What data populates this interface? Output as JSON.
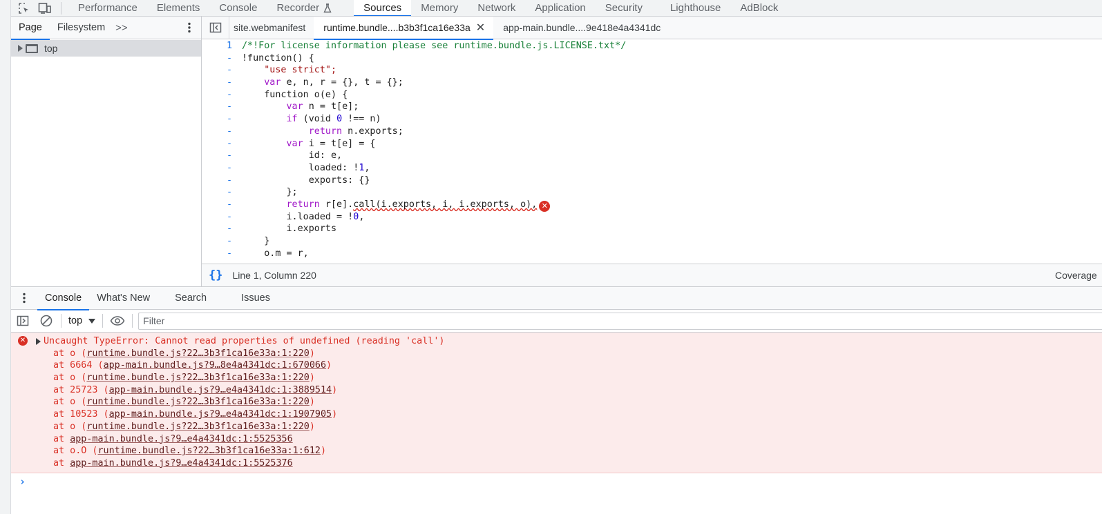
{
  "top_tabs": [
    "Performance",
    "Elements",
    "Console",
    "Recorder",
    "Sources",
    "Memory",
    "Network",
    "Application",
    "Security",
    "Lighthouse",
    "AdBlock"
  ],
  "active_top_tab": "Sources",
  "navigator": {
    "tabs": [
      "Page",
      "Filesystem"
    ],
    "more": ">>",
    "tree_top_label": "top"
  },
  "editor": {
    "tabs": [
      "site.webmanifest",
      "runtime.bundle....b3b3f1ca16e33a",
      "app-main.bundle....9e418e4a4341dc"
    ],
    "active_tab": "runtime.bundle....b3b3f1ca16e33a",
    "line_number": "1",
    "code": {
      "line1": "/*!For license information please see runtime.bundle.js.LICENSE.txt*/",
      "line2": "!function() {",
      "line3": "\"use strict\";",
      "line4_kw": "var",
      "line4_rest": " e, n, r = {}, t = {};",
      "line5": "function o(e) {",
      "line6_kw": "var",
      "line6_rest": " n = t[e];",
      "line7_kw": "if",
      "line7_a": " (void ",
      "line7_num": "0",
      "line7_b": " !== n)",
      "line8_kw": "return",
      "line8_rest": " n.exports;",
      "line9_kw": "var",
      "line9_rest": " i = t[e] = {",
      "line10": "id: e,",
      "line11_a": "loaded: !",
      "line11_num": "1",
      "line11_b": ",",
      "line12": "exports: {}",
      "line13": "};",
      "line14_kw": "return",
      "line14_a": " r[e].",
      "line14_err": "call(i.exports, i, i.exports, o),",
      "line15_a": "i.loaded = !",
      "line15_num": "0",
      "line15_b": ",",
      "line16": "i.exports",
      "line17": "}",
      "line18": "o.m = r,"
    },
    "status": "Line 1, Column 220",
    "coverage": "Coverage"
  },
  "drawer": {
    "tabs": [
      "Console",
      "What's New",
      "Search",
      "Issues"
    ],
    "active_tab": "Console",
    "context": "top",
    "filter_placeholder": "Filter"
  },
  "error": {
    "message": "Uncaught TypeError: Cannot read properties of undefined (reading 'call')",
    "stack": [
      {
        "prefix": "at o (",
        "link": "runtime.bundle.js?22…3b3f1ca16e33a:1:220",
        "suffix": ")"
      },
      {
        "prefix": "at 6664 (",
        "link": "app-main.bundle.js?9…8e4a4341dc:1:670066",
        "suffix": ")"
      },
      {
        "prefix": "at o (",
        "link": "runtime.bundle.js?22…3b3f1ca16e33a:1:220",
        "suffix": ")"
      },
      {
        "prefix": "at 25723 (",
        "link": "app-main.bundle.js?9…e4a4341dc:1:3889514",
        "suffix": ")"
      },
      {
        "prefix": "at o (",
        "link": "runtime.bundle.js?22…3b3f1ca16e33a:1:220",
        "suffix": ")"
      },
      {
        "prefix": "at 10523 (",
        "link": "app-main.bundle.js?9…e4a4341dc:1:1907905",
        "suffix": ")"
      },
      {
        "prefix": "at o (",
        "link": "runtime.bundle.js?22…3b3f1ca16e33a:1:220",
        "suffix": ")"
      },
      {
        "prefix": "at ",
        "link": "app-main.bundle.js?9…e4a4341dc:1:5525356",
        "suffix": ""
      },
      {
        "prefix": "at o.O (",
        "link": "runtime.bundle.js?22…3b3f1ca16e33a:1:612",
        "suffix": ")"
      },
      {
        "prefix": "at ",
        "link": "app-main.bundle.js?9…e4a4341dc:1:5525376",
        "suffix": ""
      }
    ]
  },
  "prompt_symbol": "›",
  "icons": {
    "inspect": "inspect-element-icon",
    "device": "device-toolbar-icon",
    "recorder_flask": "flask-icon",
    "kebab": "more-vertical-icon",
    "pretty_print": "pretty-print-icon",
    "sidebar_toggle": "sidebar-toggle-icon",
    "clear": "clear-console-icon",
    "eye": "live-expression-eye-icon",
    "error": "error-icon"
  },
  "colors": {
    "accent": "#1a73e8",
    "error": "#d93025",
    "error_bg": "#fcebeb"
  }
}
